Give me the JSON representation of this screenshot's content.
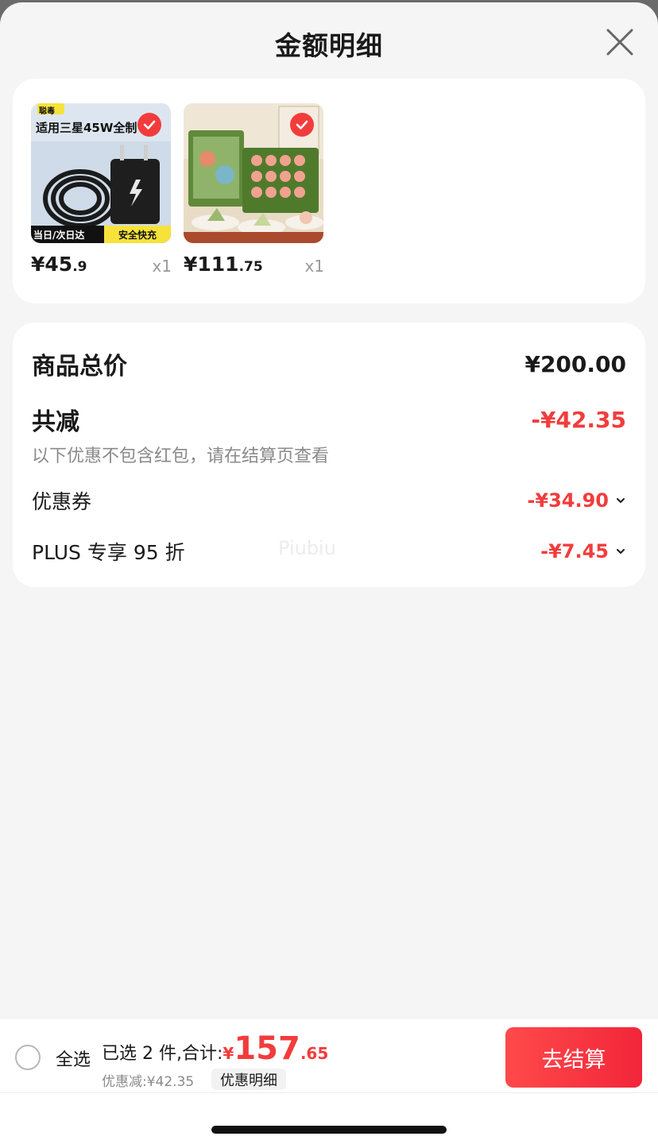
{
  "sheet": {
    "title": "金额明细",
    "close_icon": "close-icon"
  },
  "products": [
    {
      "thumb_badge": "聪毒",
      "thumb_title": "适用三星45W全制",
      "thumb_footer_left": "当日/次日达",
      "thumb_footer_right": "安全快充",
      "price_int": "¥45",
      "price_dec": ".9",
      "qty": "x1",
      "checked": true
    },
    {
      "price_int": "¥111",
      "price_dec": ".75",
      "qty": "x1",
      "checked": true
    }
  ],
  "summary": {
    "subtotal_label": "商品总价",
    "subtotal_value": "¥200.00",
    "reduction_label": "共减",
    "reduction_value": "-¥42.35",
    "note": "以下优惠不包含红包，请在结算页查看",
    "coupon_label": "优惠券",
    "coupon_value": "-¥34.90",
    "plus_label": "PLUS 专享 95 折",
    "plus_value": "-¥7.45",
    "watermark": "Piubiu"
  },
  "footer": {
    "select_all": "全选",
    "selected_count": "已选 2 件,合计:",
    "currency": "¥",
    "total_int": "157",
    "total_dec": ".65",
    "discount_line": "优惠减:¥42.35",
    "detail_chip": "优惠明细",
    "checkout": "去结算"
  },
  "colors": {
    "accent": "#f23c3c",
    "background": "#f5f5f5"
  }
}
